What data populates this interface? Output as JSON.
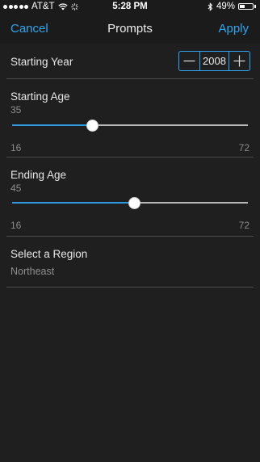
{
  "status_bar": {
    "carrier": "AT&T",
    "time": "5:28 PM",
    "battery": "49%",
    "battery_level": 0.49,
    "signal_bars": 5,
    "icons": [
      "wifi-icon",
      "activity-spinner-icon",
      "bluetooth-icon",
      "battery-icon"
    ]
  },
  "nav": {
    "cancel_label": "Cancel",
    "title": "Prompts",
    "apply_label": "Apply"
  },
  "starting_year": {
    "label": "Starting Year",
    "value": "2008"
  },
  "starting_age": {
    "label": "Starting Age",
    "value": "35",
    "value_num": 35,
    "min": "16",
    "max": "72",
    "min_num": 16,
    "max_num": 72
  },
  "ending_age": {
    "label": "Ending Age",
    "value": "45",
    "value_num": 45,
    "min": "16",
    "max": "72",
    "min_num": 16,
    "max_num": 72
  },
  "region": {
    "label": "Select a Region",
    "value": "Northeast"
  },
  "colors": {
    "accent": "#2ea6f0",
    "background": "#1f1f1f",
    "bar_background": "#1b1b1b",
    "divider": "#4a4a4a",
    "secondary_text": "#8e8e8e"
  }
}
